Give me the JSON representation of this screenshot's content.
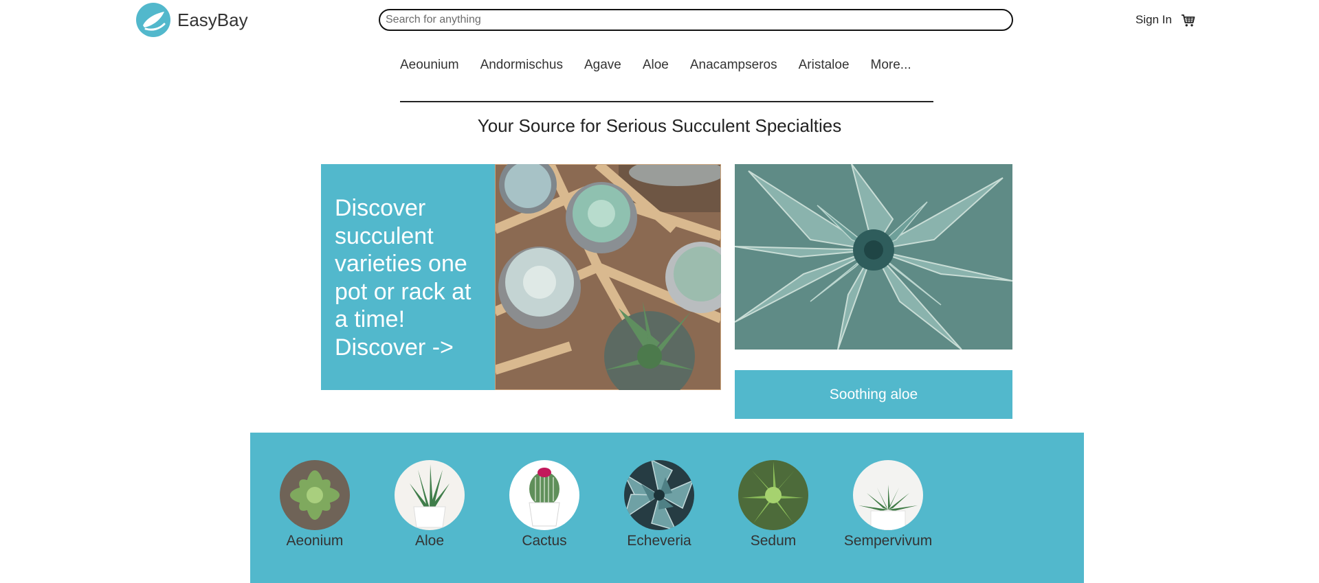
{
  "brand": {
    "name": "EasyBay",
    "accent": "#52b8cc"
  },
  "search": {
    "placeholder": "Search for anything",
    "value": ""
  },
  "header": {
    "signin_label": "Sign In",
    "cart_icon": "cart-icon"
  },
  "nav": {
    "items": [
      "Aeounium",
      "Andormischus",
      "Agave",
      "Aloe",
      "Anacampseros",
      "Aristaloe",
      "More..."
    ]
  },
  "tagline": "Your Source for Serious Succulent Specialties",
  "hero": {
    "text": "Discover succulent varieties one pot or rack at a time! Discover ->",
    "image_subject": "succulents in wooden rack",
    "side_image_subject": "agave rosette",
    "side_caption": "Soothing aloe"
  },
  "categories": [
    {
      "label": "Aeonium"
    },
    {
      "label": "Aloe"
    },
    {
      "label": "Cactus"
    },
    {
      "label": "Echeveria"
    },
    {
      "label": "Sedum"
    },
    {
      "label": "Sempervivum"
    }
  ]
}
